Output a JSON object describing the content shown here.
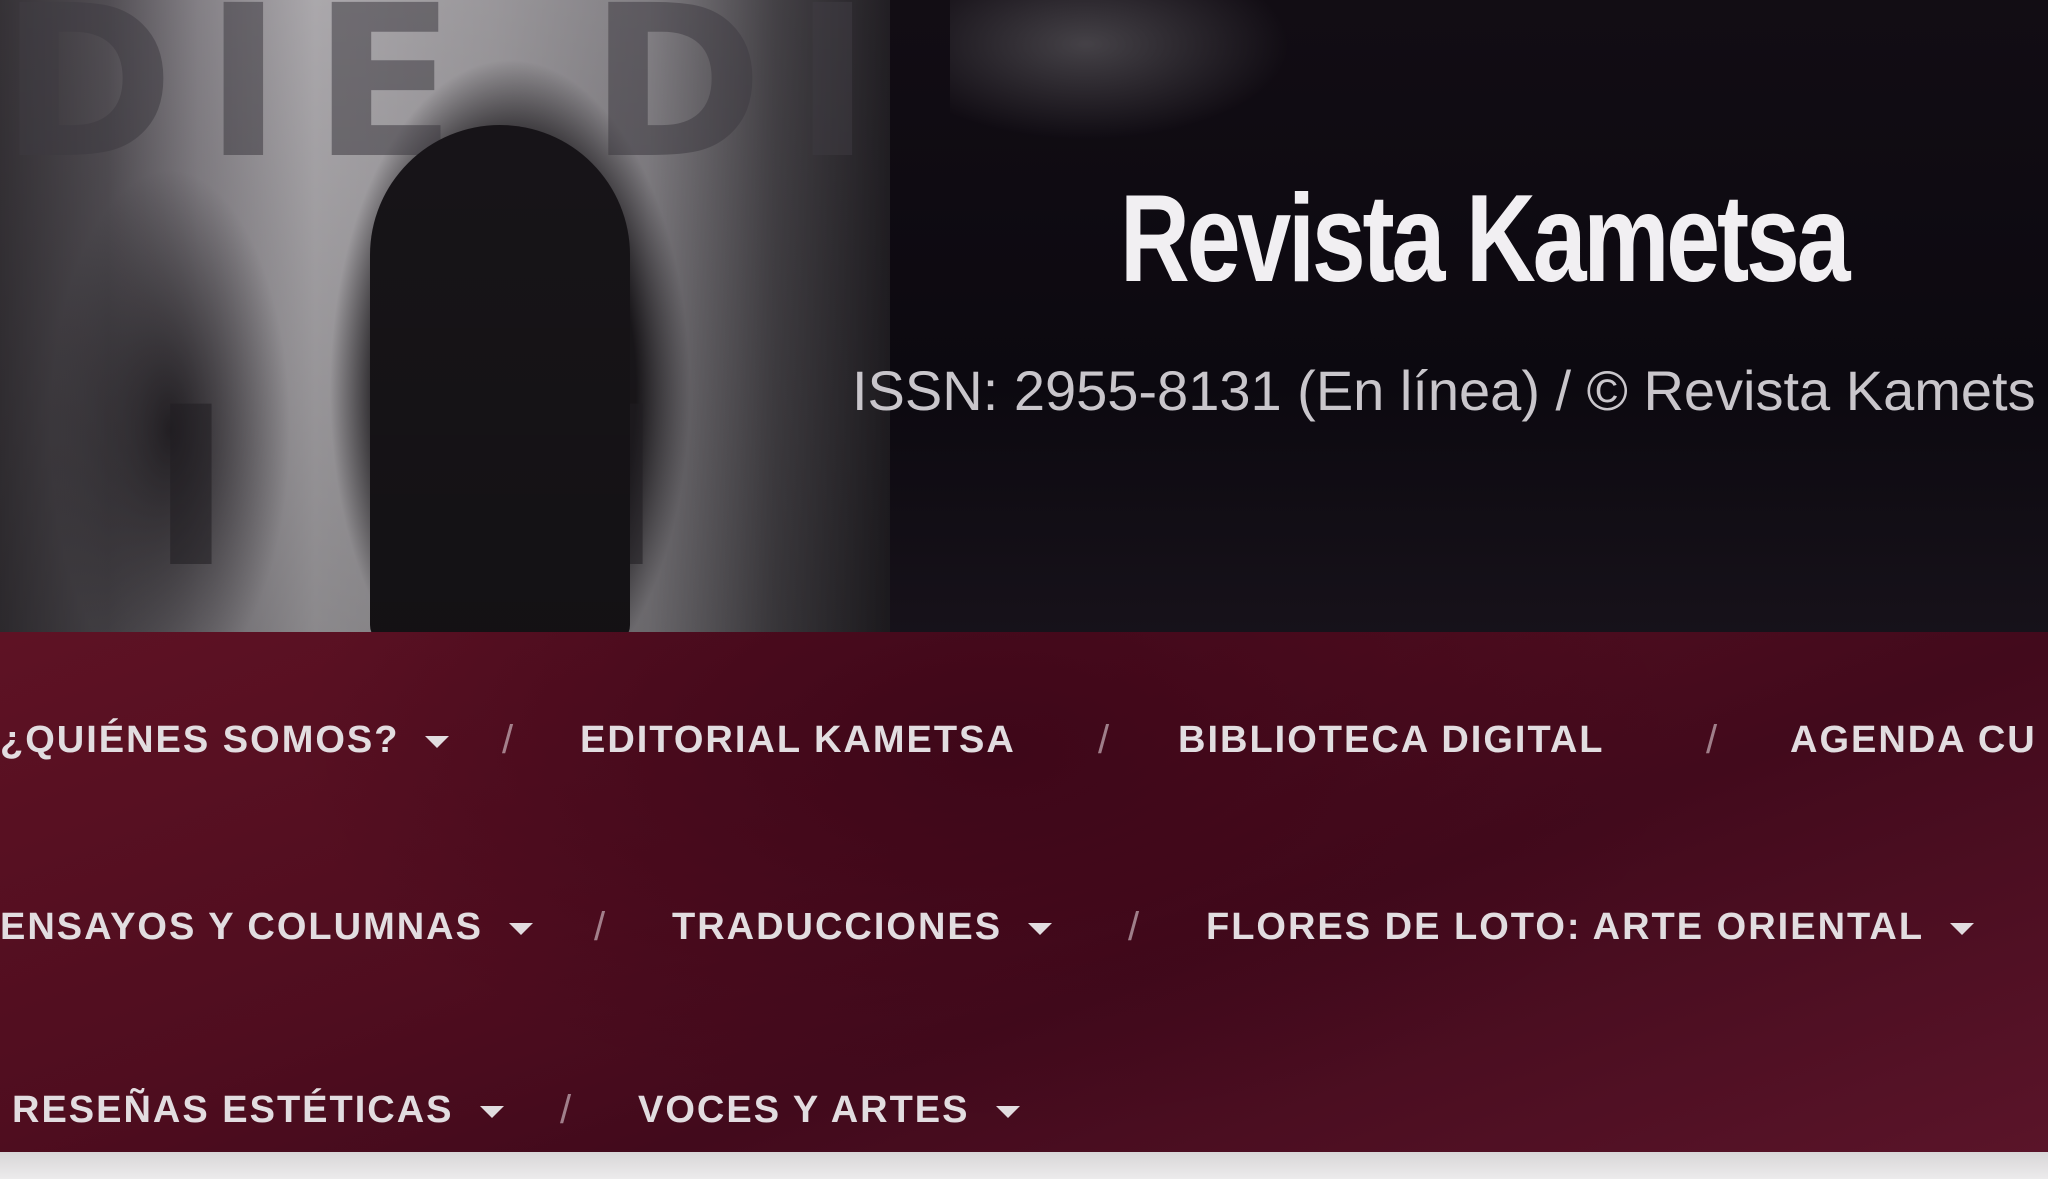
{
  "header": {
    "title": "Revista Kametsa",
    "subtitle": "ISSN: 2955-8131 (En línea) / © Revista Kamets",
    "photo_letters_top": "DIE DIE",
    "photo_letters_bottom": "I DI"
  },
  "nav": {
    "separator": "/",
    "row1": [
      {
        "label": "¿QUIÉNES SOMOS?",
        "has_dropdown": true
      },
      {
        "label": "EDITORIAL KAMETSA",
        "has_dropdown": false
      },
      {
        "label": "BIBLIOTECA DIGITAL",
        "has_dropdown": false
      },
      {
        "label": "AGENDA CU",
        "has_dropdown": false
      }
    ],
    "row2": [
      {
        "label": "ENSAYOS Y COLUMNAS",
        "has_dropdown": true
      },
      {
        "label": "TRADUCCIONES",
        "has_dropdown": true
      },
      {
        "label": "FLORES DE LOTO: ARTE ORIENTAL",
        "has_dropdown": true
      }
    ],
    "row3": [
      {
        "label": "RESEÑAS ESTÉTICAS",
        "has_dropdown": true
      },
      {
        "label": "VOCES Y ARTES",
        "has_dropdown": true
      }
    ]
  },
  "colors": {
    "nav_background": "#4f0d1f",
    "nav_text": "#e2dde0",
    "title_text": "#f1eff2",
    "banner_dark": "#0c0910"
  }
}
